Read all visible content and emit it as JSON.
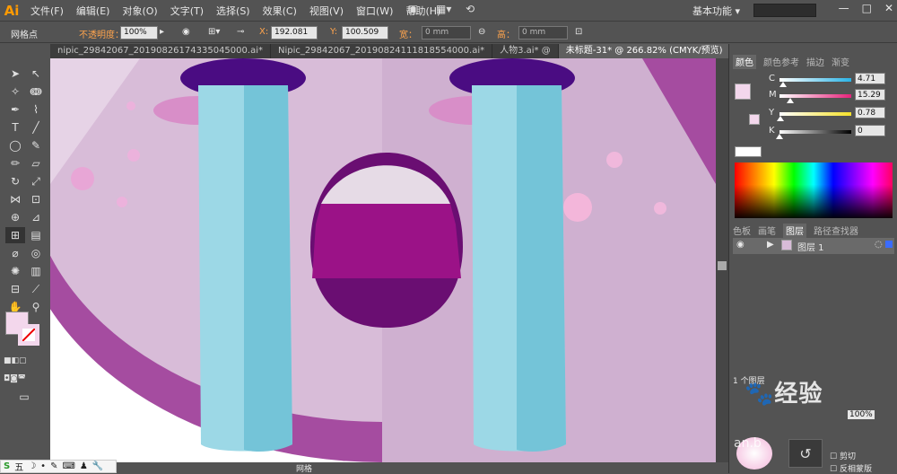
{
  "app": {
    "logo": "Ai"
  },
  "menu": [
    "文件(F)",
    "编辑(E)",
    "对象(O)",
    "文字(T)",
    "选择(S)",
    "效果(C)",
    "视图(V)",
    "窗口(W)",
    "帮助(H)"
  ],
  "workspace": "基本功能",
  "window_controls": [
    "—",
    "□",
    "✕"
  ],
  "control_bar": {
    "tool_label": "网格点",
    "opacity_label": "不透明度：",
    "opacity_value": "100%",
    "x_label": "X:",
    "x_value": "192.081",
    "y_label": "Y:",
    "y_value": "100.509",
    "w_label": "宽：",
    "w_value": "0 mm",
    "h_label": "高：",
    "h_value": "0 mm"
  },
  "doc_tabs": [
    {
      "label": "nipic_29842067_20190826174335045000.ai*"
    },
    {
      "label": "Nipic_29842067_20190824111818554000.ai*"
    },
    {
      "label": "人物3.ai* @"
    },
    {
      "label": "未标题-31* @ 266.82% (CMYK/预览)",
      "active": true
    }
  ],
  "color_panel": {
    "tabs": [
      "颜色",
      "颜色参考",
      "描边",
      "渐变"
    ],
    "channels": [
      {
        "name": "C",
        "value": "4.71",
        "color": "#2ab3e6",
        "fill": 0.047
      },
      {
        "name": "M",
        "value": "15.29",
        "color": "#e6227a",
        "fill": 0.153
      },
      {
        "name": "Y",
        "value": "0.78",
        "color": "#f5e12a",
        "fill": 0.008
      },
      {
        "name": "K",
        "value": "0",
        "color": "#777777",
        "fill": 0.0
      }
    ],
    "current_fill": "#f3d7ec"
  },
  "layers_panel": {
    "tabs": [
      "色板",
      "画笔",
      "图层",
      "路径查找器"
    ],
    "layers": [
      {
        "name": "图层 1"
      }
    ],
    "count_label": "1 个图层"
  },
  "bottom_panel": {
    "labels": [
      "剪切",
      "反相蒙版"
    ],
    "percent": "100%"
  },
  "status": {
    "label": "网格"
  },
  "watermark": "经验",
  "watermark_sub": "an.b",
  "ime": [
    "五",
    "☽",
    "•",
    "✎",
    "⌨",
    "♟",
    "🔧"
  ]
}
